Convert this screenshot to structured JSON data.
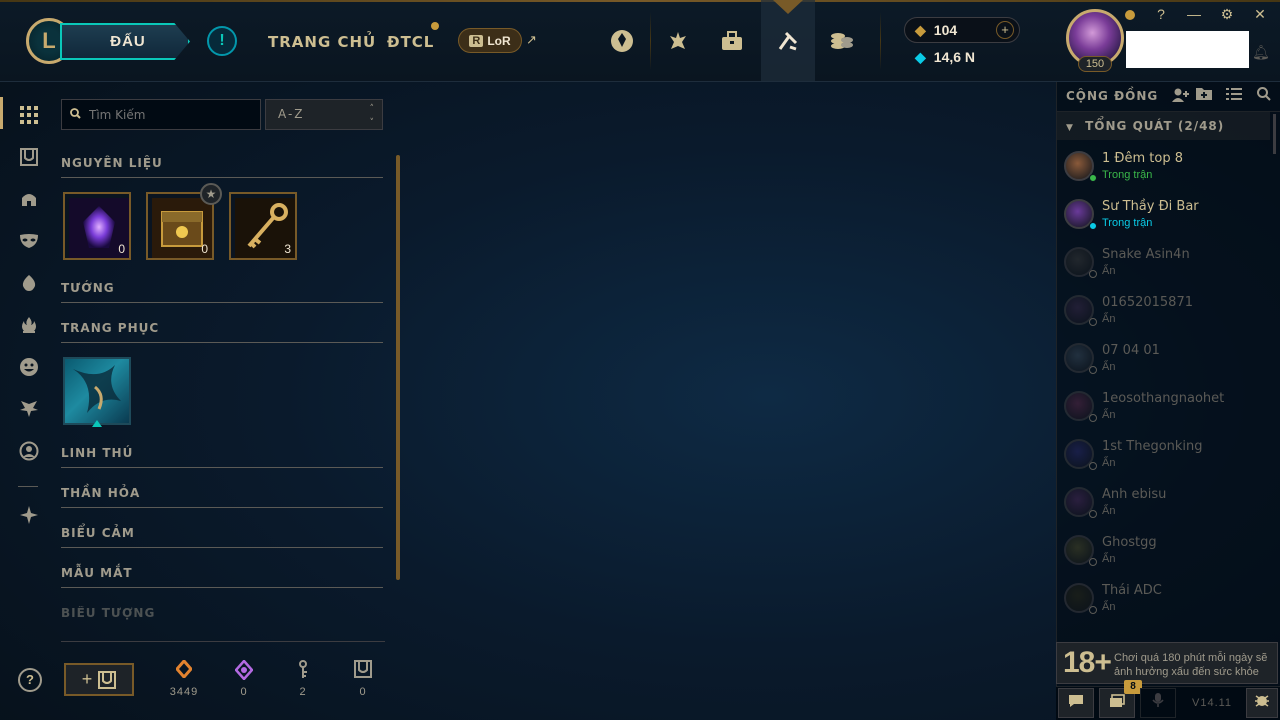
{
  "header": {
    "logo_letter": "L",
    "play_label": "ĐẤU",
    "alert_label": "!",
    "nav": [
      "TRANG CHỦ",
      "ĐTCL"
    ],
    "lor_label": "LoR",
    "lor_icon_letter": "R",
    "ext_glyph": "↗",
    "icons": [
      "clash-icon",
      "challenges-icon",
      "store-icon",
      "collection-icon",
      "loot-icon"
    ],
    "rp": "104",
    "rp_glyph": "◆",
    "be": "14,6 N",
    "be_glyph": "◆",
    "plus_label": "+",
    "level": "150",
    "window_buttons": [
      "?",
      "—",
      "⚙",
      "✕"
    ]
  },
  "left_nav": {
    "icons": [
      "grid-icon",
      "chest-icon",
      "helmet-icon",
      "mask-icon",
      "ward-icon",
      "flame-icon",
      "emote-icon",
      "companion-icon",
      "profile-icon",
      "crafting-icon"
    ],
    "help_label": "?"
  },
  "loot": {
    "search_placeholder": "Tìm Kiếm",
    "sort_value": "A-Z",
    "categories": {
      "materials": "NGUYÊN LIỆU",
      "champions": "TƯỚNG",
      "skins": "TRANG PHỤC",
      "companions": "LINH THÚ",
      "wards": "THẦN HỎA",
      "emotes": "BIỂU CẢM",
      "eye_colors": "MẪU MẮT",
      "icons": "BIỂU TƯỢNG"
    },
    "materials": [
      {
        "name": "Orange Essence Gem",
        "count": "0"
      },
      {
        "name": "Chest",
        "count": "0"
      },
      {
        "name": "Key",
        "count": "3"
      }
    ],
    "bottom": {
      "craft_plus": "+",
      "resources": [
        {
          "icon": "orange-essence-icon",
          "value": "3449",
          "color": "#e2832f"
        },
        {
          "icon": "mythic-essence-icon",
          "value": "0",
          "color": "#b36ae2"
        },
        {
          "icon": "key-fragment-icon",
          "value": "2",
          "color": "#a09b8c"
        },
        {
          "icon": "chest-icon",
          "value": "0",
          "color": "#a09b8c"
        }
      ]
    }
  },
  "social": {
    "title": "CỘNG ĐỒNG",
    "group": "TỔNG QUÁT (2/48)",
    "friends": [
      {
        "name": "1 Đêm top 8",
        "status": "Trong trận",
        "status_color": "#3ab84a",
        "dot": "#3ab84a",
        "avatar": "#8a5a3a"
      },
      {
        "name": "Sư Thầy Đi Bar",
        "status": "Trong trận",
        "status_color": "#0acbe6",
        "dot": "#0acbe6",
        "avatar": "#6a3a9a"
      },
      {
        "name": "Snake Asin4n",
        "status": "Ẩn",
        "status_color": "#5b5a56",
        "dot": "#5b5a56",
        "avatar": "#3a3a3a"
      },
      {
        "name": "01652015871",
        "status": "Ẩn",
        "status_color": "#5b5a56",
        "dot": "#5b5a56",
        "avatar": "#3a2a4a"
      },
      {
        "name": "07 04 01",
        "status": "Ẩn",
        "status_color": "#5b5a56",
        "dot": "#5b5a56",
        "avatar": "#3a4a5a"
      },
      {
        "name": "1eosothangnaohet",
        "status": "Ẩn",
        "status_color": "#5b5a56",
        "dot": "#5b5a56",
        "avatar": "#5a2a4a"
      },
      {
        "name": "1st Thegonking",
        "status": "Ẩn",
        "status_color": "#5b5a56",
        "dot": "#5b5a56",
        "avatar": "#2a2a6a"
      },
      {
        "name": "Anh ebisu",
        "status": "Ẩn",
        "status_color": "#5b5a56",
        "dot": "#5b5a56",
        "avatar": "#4a2a5a"
      },
      {
        "name": "Ghostgg",
        "status": "Ẩn",
        "status_color": "#5b5a56",
        "dot": "#5b5a56",
        "avatar": "#4a4a2a"
      },
      {
        "name": "Thái ADC",
        "status": "Ẩn",
        "status_color": "#5b5a56",
        "dot": "#5b5a56",
        "avatar": "#2a2a1a"
      }
    ],
    "warning_badge": "18+",
    "warning": "Chơi quá 180 phút mỗi ngày sẽ ảnh hưởng xấu đến sức khỏe",
    "notif_count": "8",
    "version": "V14.11"
  },
  "colors": {
    "gold": "#c8aa6e",
    "teal": "#0ac8b9",
    "dark": "#010a13"
  }
}
